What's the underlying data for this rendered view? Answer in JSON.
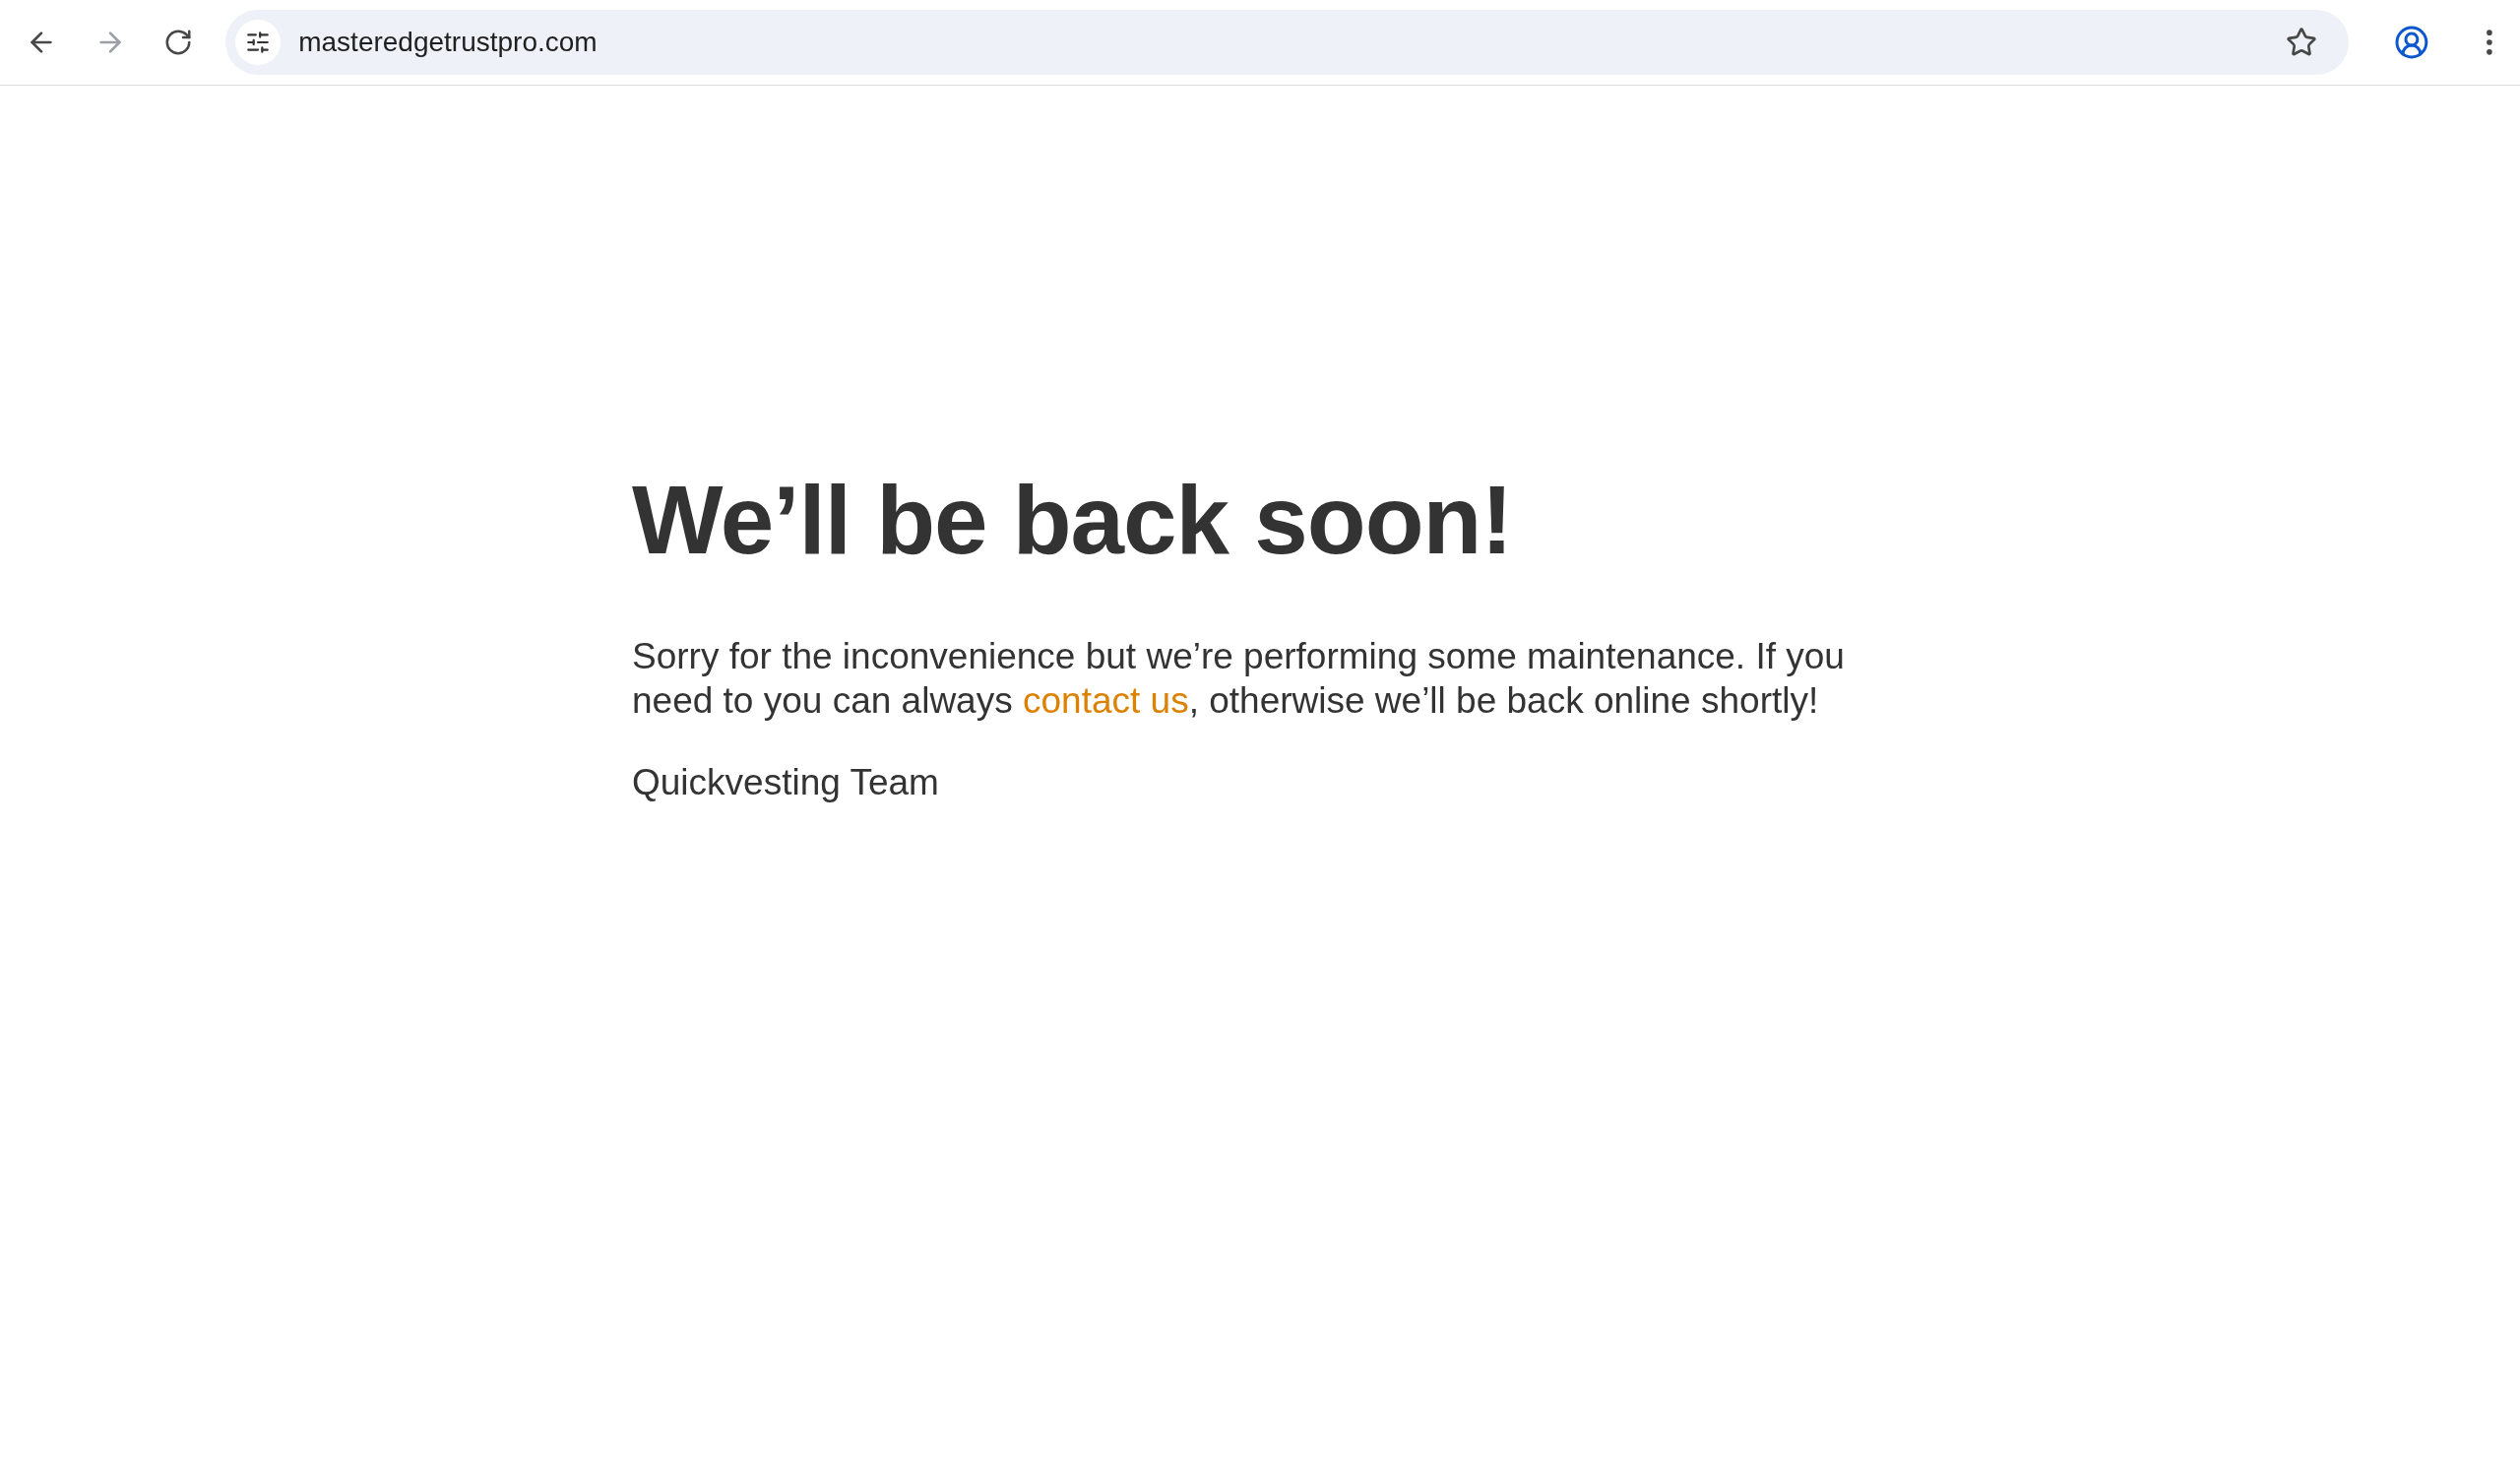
{
  "browser": {
    "url": "masteredgetrustpro.com",
    "back_disabled": false,
    "forward_disabled": true
  },
  "page": {
    "heading": "We’ll be back soon!",
    "message": {
      "before": "Sorry for the inconvenience but we’re performing some maintenance. If you need to you can always ",
      "link": "contact us",
      "after": ", otherwise we’ll be back online shortly!"
    },
    "signature": "Quickvesting Team"
  }
}
